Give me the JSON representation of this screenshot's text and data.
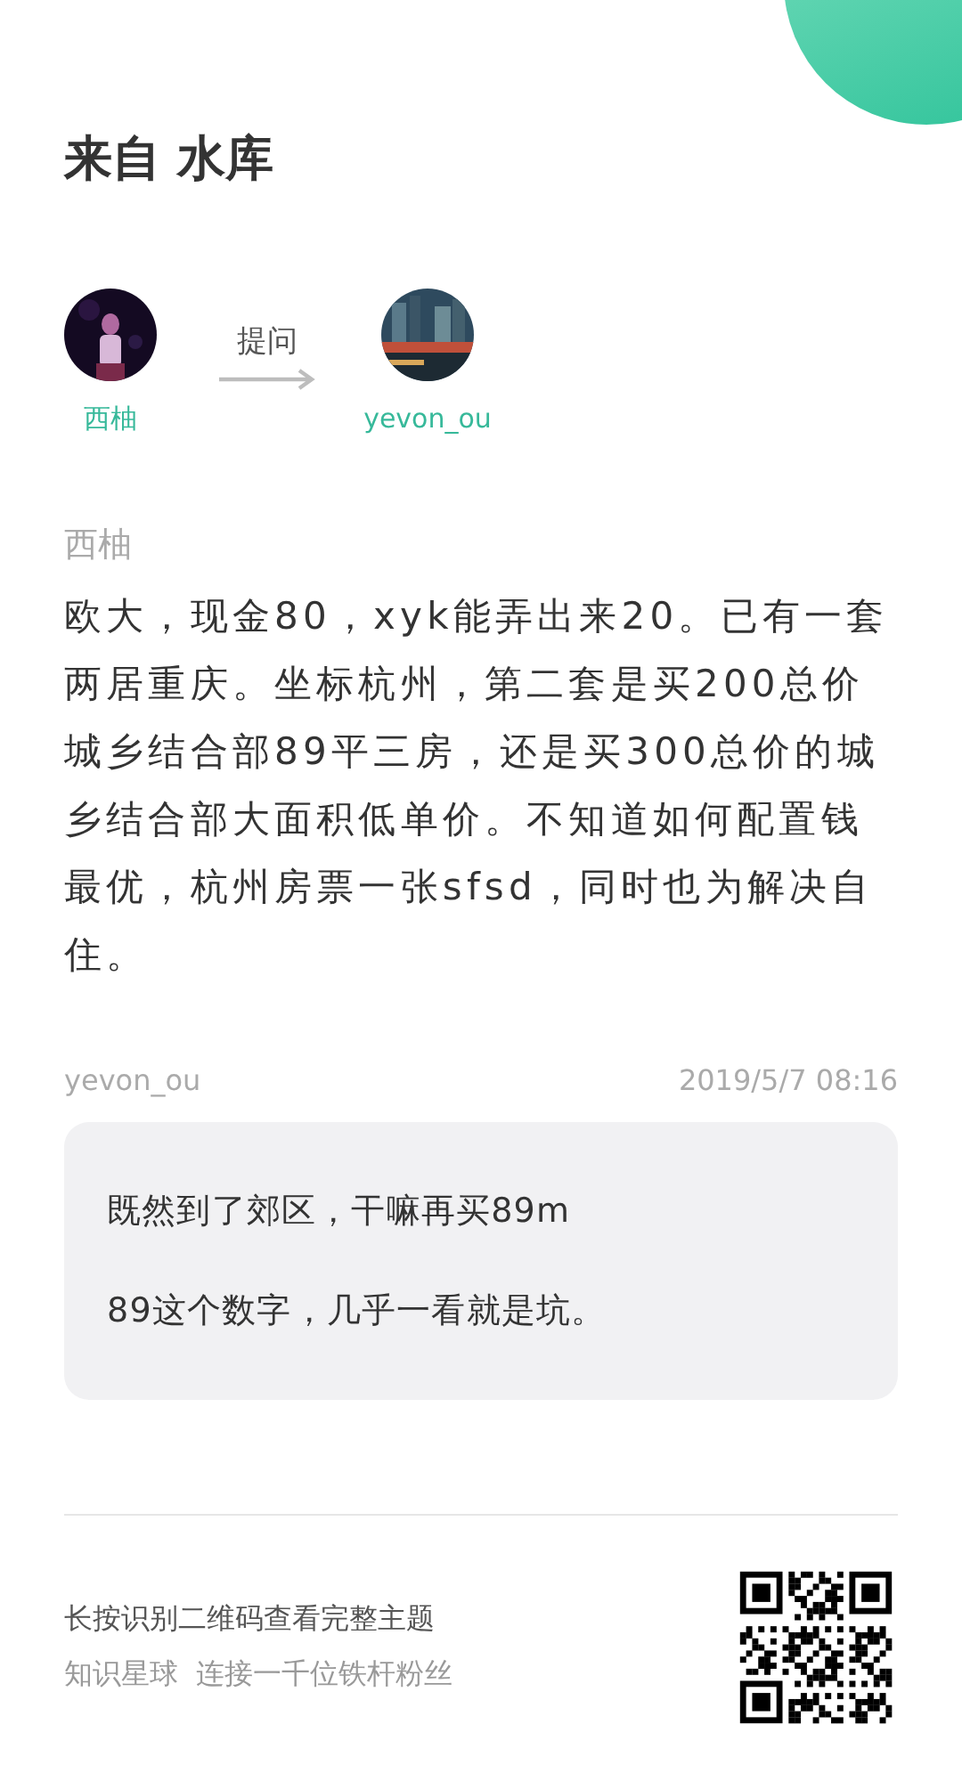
{
  "header": {
    "title": "来自 水库"
  },
  "flow": {
    "asker": {
      "name": "西柚"
    },
    "action": "提问",
    "answerer": {
      "name": "yevon_ou"
    }
  },
  "question": {
    "author": "西柚",
    "text": "欧大，现金80，xyk能弄出来20。已有一套两居重庆。坐标杭州，第二套是买200总价城乡结合部89平三房，还是买300总价的城乡结合部大面积低单价。不知道如何配置钱最优，杭州房票一张sfsd，同时也为解决自住。"
  },
  "answer": {
    "author": "yevon_ou",
    "time": "2019/5/7 08:16",
    "paragraphs": [
      "既然到了郊区，干嘛再买89m",
      "89这个数字，几乎一看就是坑。"
    ]
  },
  "footer": {
    "lines": [
      "长按识别二维码查看完整主题",
      "知识星球  连接一千位铁杆粉丝"
    ]
  }
}
